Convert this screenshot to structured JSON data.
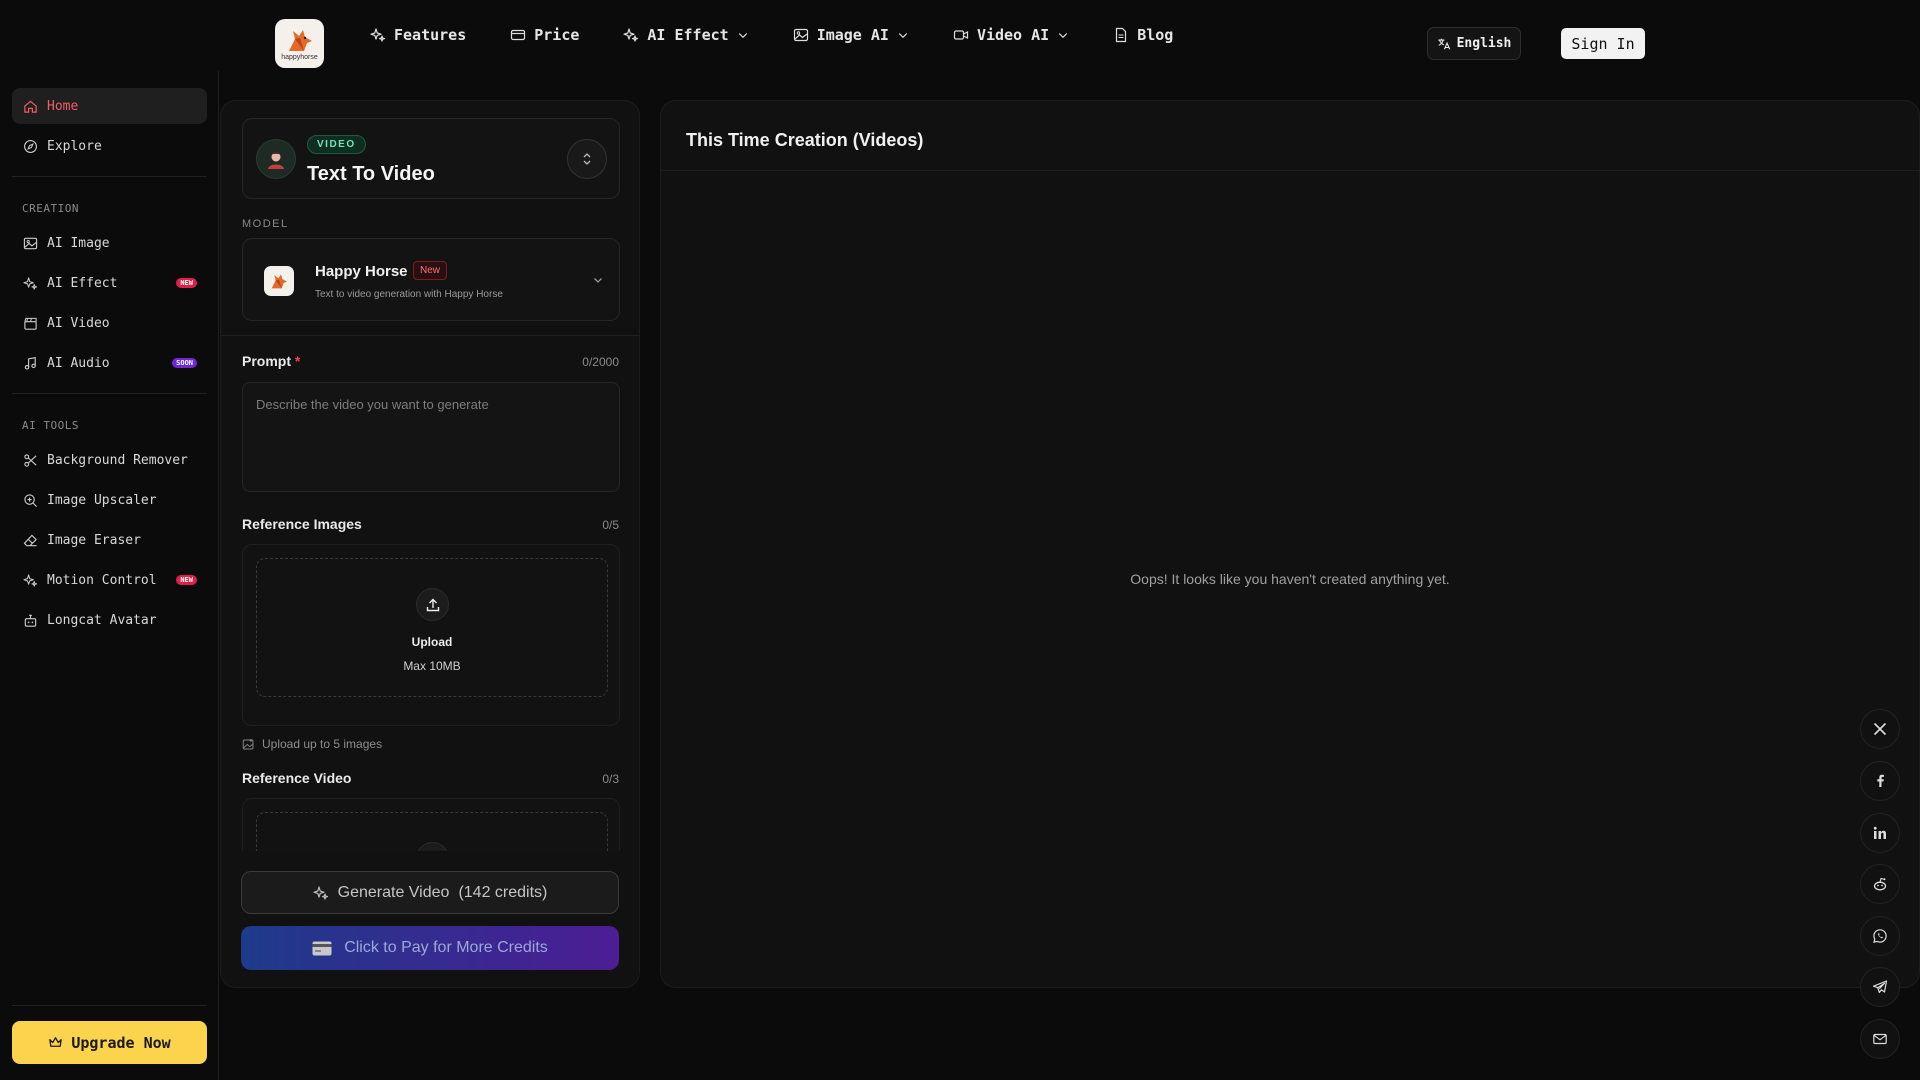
{
  "brand": {
    "logo_text": "happyhorse"
  },
  "nav": {
    "items": [
      {
        "label": "Features",
        "icon": "sparkles-icon"
      },
      {
        "label": "Price",
        "icon": "card-icon"
      },
      {
        "label": "AI Effect",
        "icon": "sparkles-icon",
        "dropdown": true
      },
      {
        "label": "Image AI",
        "icon": "image-icon",
        "dropdown": true
      },
      {
        "label": "Video AI",
        "icon": "video-icon",
        "dropdown": true
      },
      {
        "label": "Blog",
        "icon": "document-icon"
      }
    ],
    "language": "English",
    "sign_in": "Sign In"
  },
  "sidebar": {
    "top": [
      {
        "label": "Home",
        "icon": "home-icon",
        "active": true
      },
      {
        "label": "Explore",
        "icon": "compass-icon"
      }
    ],
    "creation_heading": "CREATION",
    "creation": [
      {
        "label": "AI Image",
        "icon": "image-icon"
      },
      {
        "label": "AI Effect",
        "icon": "sparkles-icon",
        "badge": "NEW"
      },
      {
        "label": "AI Video",
        "icon": "clapper-icon"
      },
      {
        "label": "AI Audio",
        "icon": "music-icon",
        "badge": "SOON"
      }
    ],
    "tools_heading": "AI TOOLS",
    "tools": [
      {
        "label": "Background Remover",
        "icon": "scissors-icon"
      },
      {
        "label": "Image Upscaler",
        "icon": "zoom-icon"
      },
      {
        "label": "Image Eraser",
        "icon": "eraser-icon"
      },
      {
        "label": "Motion Control",
        "icon": "sparkles-icon",
        "badge": "NEW"
      },
      {
        "label": "Longcat Avatar",
        "icon": "bot-icon"
      }
    ],
    "upgrade": "Upgrade Now"
  },
  "panel": {
    "type_tag": "VIDEO",
    "type_title": "Text To Video",
    "model_label": "MODEL",
    "model": {
      "name": "Happy Horse",
      "tag": "New",
      "desc": "Text to video generation with Happy Horse"
    },
    "prompt": {
      "label": "Prompt",
      "required": "*",
      "counter": "0/2000",
      "placeholder": "Describe the video you want to generate",
      "value": ""
    },
    "ref_images": {
      "label": "Reference Images",
      "counter": "0/5",
      "upload": "Upload",
      "max": "Max 10MB",
      "hint": "Upload up to 5 images"
    },
    "ref_video": {
      "label": "Reference Video",
      "counter": "0/3"
    },
    "generate": "Generate Video",
    "credits": "(142 credits)",
    "pay": "Click to Pay for More Credits"
  },
  "creation": {
    "title": "This Time Creation (Videos)",
    "empty": "Oops! It looks like you haven't created anything yet."
  },
  "share": [
    "x-icon",
    "facebook-icon",
    "linkedin-icon",
    "reddit-icon",
    "whatsapp-icon",
    "telegram-icon",
    "mail-icon"
  ],
  "colors": {
    "accent": "#f25c6a",
    "upgrade": "#fcd34d",
    "video_tag": "#6ee7b7"
  }
}
